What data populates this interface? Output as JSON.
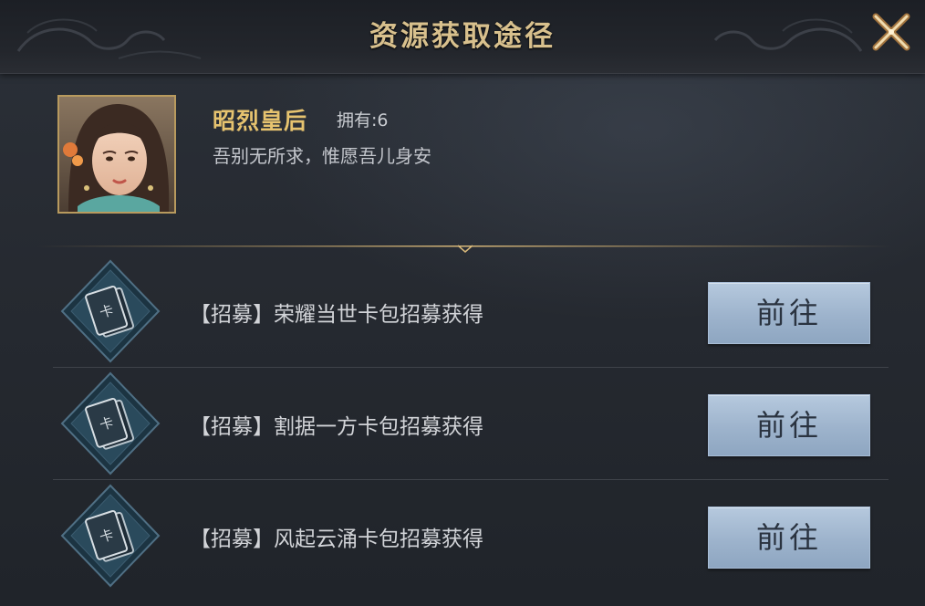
{
  "header": {
    "title": "资源获取途径",
    "close_icon": "close-x-icon"
  },
  "hero": {
    "name": "昭烈皇后",
    "owned_label": "拥有:6",
    "quote": "吾别无所求，惟愿吾儿身安"
  },
  "sources": [
    {
      "icon": "card-pack-icon",
      "text": "【招募】荣耀当世卡包招募获得",
      "button": "前往"
    },
    {
      "icon": "card-pack-icon",
      "text": "【招募】割据一方卡包招募获得",
      "button": "前往"
    },
    {
      "icon": "card-pack-icon",
      "text": "【招募】风起云涌卡包招募获得",
      "button": "前往"
    }
  ],
  "colors": {
    "title_gold": "#d8c08d",
    "name_gold": "#e6c36f",
    "button_blue": "#9db3cc"
  }
}
